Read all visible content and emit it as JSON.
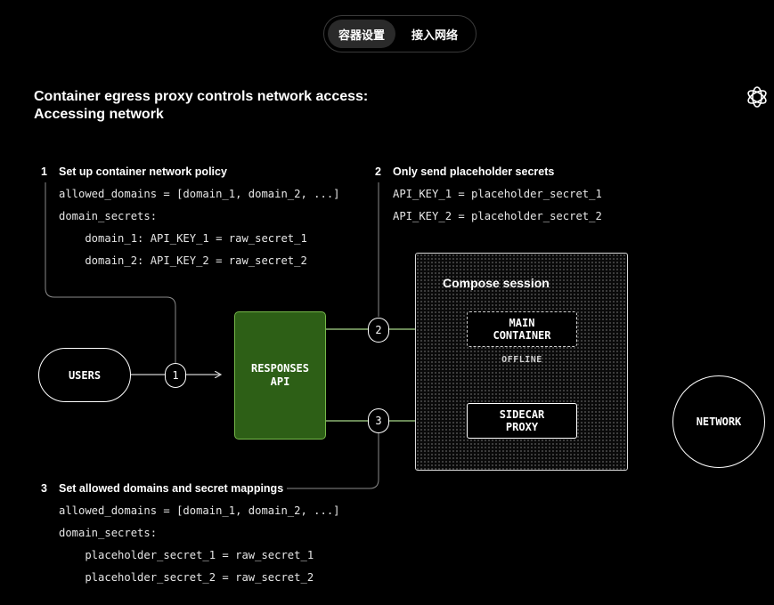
{
  "tabs": [
    {
      "label": "容器设置",
      "active": true
    },
    {
      "label": "接入网络",
      "active": false
    }
  ],
  "title_line1": "Container egress proxy controls network access:",
  "title_line2": "Accessing network",
  "logo_icon": "openai-logo-icon",
  "step1": {
    "number": "1",
    "heading": "Set up container network policy",
    "lines": [
      "allowed_domains = [domain_1, domain_2, ...]",
      "domain_secrets:",
      "    domain_1: API_KEY_1 = raw_secret_1",
      "    domain_2: API_KEY_2 = raw_secret_2"
    ]
  },
  "step2": {
    "number": "2",
    "heading": "Only send placeholder secrets",
    "lines": [
      "API_KEY_1 = placeholder_secret_1",
      "API_KEY_2 = placeholder_secret_2"
    ]
  },
  "step3": {
    "number": "3",
    "heading": "Set allowed domains and secret mappings",
    "lines": [
      "allowed_domains = [domain_1, domain_2, ...]",
      "domain_secrets:",
      "    placeholder_secret_1 = raw_secret_1",
      "    placeholder_secret_2 = raw_secret_2"
    ]
  },
  "diagram": {
    "users": "USERS",
    "responses_api_line1": "RESPONSES",
    "responses_api_line2": "API",
    "compose_session": "Compose session",
    "main_container_line1": "MAIN",
    "main_container_line2": "CONTAINER",
    "main_status": "OFFLINE",
    "sidecar_line1": "SIDECAR",
    "sidecar_line2": "PROXY",
    "network": "NETWORK",
    "badge1": "1",
    "badge2": "2",
    "badge3": "3"
  },
  "colors": {
    "background": "#000000",
    "responses_fill": "#2d5f16",
    "responses_border": "#76b84a",
    "accent_arrow": "#a8d88a",
    "line": "#8a8a8a"
  }
}
